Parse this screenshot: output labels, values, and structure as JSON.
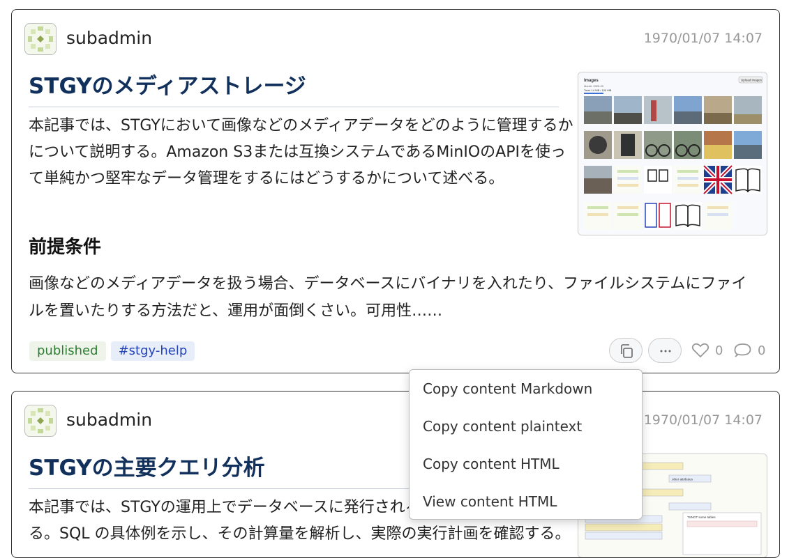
{
  "posts": [
    {
      "author": "subadmin",
      "date": "1970/01/07 14:07",
      "title": "STGYのメディアストレージ",
      "paragraph": "本記事では、STGYにおいて画像などのメディアデータをどのように管理するかについて説明する。Amazon S3または互換システムであるMinIOのAPIを使って単純かつ堅牢なデータ管理をするにはどうするかについて述べる。",
      "subheading": "前提条件",
      "paragraph2": "画像などのメディアデータを扱う場合、データベースにバイナリを入れたり、ファイルシステムにファイルを置いたりする方法だと、運用が面倒くさい。可用性……",
      "tags": [
        "published",
        "#stgy-help"
      ],
      "likes": "0",
      "replies": "0",
      "thumbnail": {
        "heading": "Images",
        "upload_label": "Upload images",
        "meta1": "Month: 2025-09",
        "meta2": "Total: 14 MB / 100 MB"
      }
    },
    {
      "author": "subadmin",
      "date": "1970/01/07 14:07",
      "title": "STGYの主要クエリ分析",
      "paragraph": "本記事では、STGYの運用上でデータベースに発行されるクエリについて分析する。SQL の具体例を示し、その計算量を解析し、実際の実行計画を確認する。",
      "thumbnail": {
        "other_attr": "other attributes",
        "ts_label": "TSNGT some tables"
      }
    }
  ],
  "menu": {
    "items": [
      "Copy content Markdown",
      "Copy content plaintext",
      "Copy content HTML",
      "View content HTML"
    ]
  },
  "icons": {
    "copy": "copy-icon",
    "more": "ellipsis-icon",
    "like": "heart-icon",
    "reply": "speech-bubble-icon",
    "avatar": "identicon-avatar"
  },
  "colors": {
    "title": "#12305c",
    "tag_published_text": "#2e7d32",
    "tag_published_bg": "#eef4ea",
    "tag_hash_text": "#2343b8",
    "tag_hash_bg": "#e8eef9",
    "date": "#999999"
  }
}
